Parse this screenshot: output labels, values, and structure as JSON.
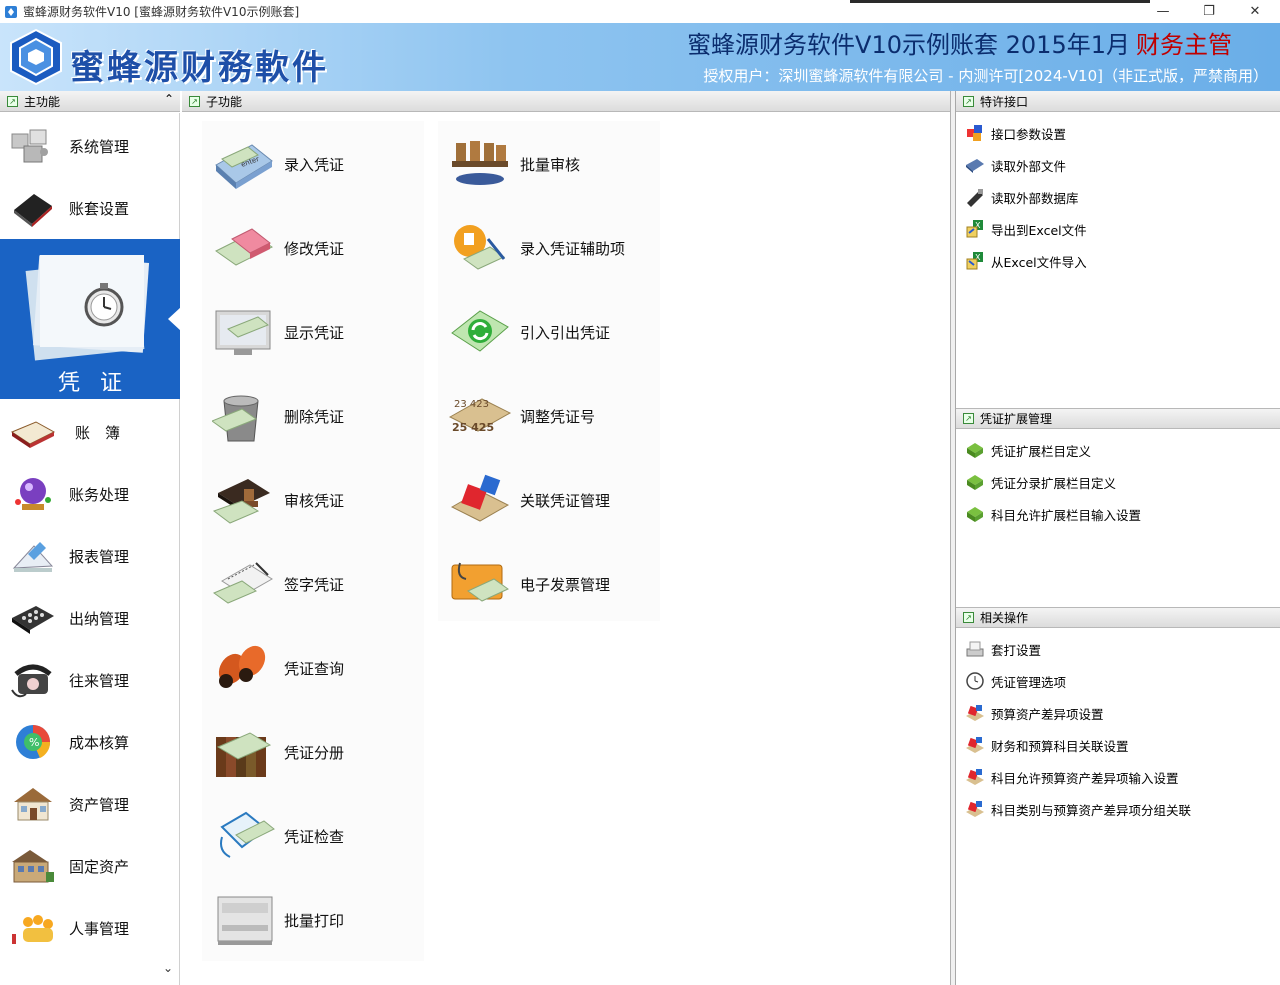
{
  "window": {
    "title": "蜜蜂源财务软件V10 [蜜蜂源财务软件V10示例账套]",
    "minimize_glyph": "—",
    "restore_glyph": "❐",
    "close_glyph": "✕"
  },
  "banner": {
    "logo_text": "蜜蜂源财務軟件",
    "account_title": "蜜蜂源财务软件V10示例账套 2015年1月",
    "role": "财务主管",
    "license": "授权用户：深圳蜜蜂源软件有限公司 - 内测许可[2024-V10]（非正式版，严禁商用）"
  },
  "left_panel": {
    "header": "主功能",
    "collapse_glyph": "⌃",
    "items_top": [
      {
        "label": "系统管理",
        "icon": "puzzle-icon"
      },
      {
        "label": "账套设置",
        "icon": "book-icon"
      }
    ],
    "selected": {
      "label": "凭证",
      "icon": "voucher-stack-icon"
    },
    "items_bottom": [
      {
        "label": "账　簿",
        "icon": "ledger-icon"
      },
      {
        "label": "账务处理",
        "icon": "crystal-ball-icon"
      },
      {
        "label": "报表管理",
        "icon": "report-icon"
      },
      {
        "label": "出纳管理",
        "icon": "cash-register-icon"
      },
      {
        "label": "往来管理",
        "icon": "phone-icon"
      },
      {
        "label": "成本核算",
        "icon": "cost-icon"
      },
      {
        "label": "资产管理",
        "icon": "house-icon"
      },
      {
        "label": "固定资产",
        "icon": "building-icon"
      },
      {
        "label": "人事管理",
        "icon": "people-icon"
      }
    ],
    "scroll_glyph": "⌄"
  },
  "middle_panel": {
    "header": "子功能",
    "col1": [
      {
        "label": "录入凭证",
        "icon": "enter-voucher-icon"
      },
      {
        "label": "修改凭证",
        "icon": "eraser-voucher-icon"
      },
      {
        "label": "显示凭证",
        "icon": "monitor-voucher-icon"
      },
      {
        "label": "删除凭证",
        "icon": "trash-voucher-icon"
      },
      {
        "label": "审核凭证",
        "icon": "stamp-voucher-icon"
      },
      {
        "label": "签字凭证",
        "icon": "sign-voucher-icon"
      },
      {
        "label": "凭证查询",
        "icon": "binoculars-icon"
      },
      {
        "label": "凭证分册",
        "icon": "books-voucher-icon"
      },
      {
        "label": "凭证检查",
        "icon": "clipboard-check-icon"
      },
      {
        "label": "批量打印",
        "icon": "printer-icon"
      }
    ],
    "col2": [
      {
        "label": "批量审核",
        "icon": "batch-stamp-icon"
      },
      {
        "label": "录入凭证辅助项",
        "icon": "assist-item-icon"
      },
      {
        "label": "引入引出凭证",
        "icon": "import-export-icon"
      },
      {
        "label": "调整凭证号",
        "icon": "renumber-icon"
      },
      {
        "label": "关联凭证管理",
        "icon": "link-puzzle-icon"
      },
      {
        "label": "电子发票管理",
        "icon": "e-invoice-icon"
      }
    ]
  },
  "right_panel": {
    "sections": [
      {
        "header": "特许接口",
        "items": [
          {
            "label": "接口参数设置",
            "icon": "puzzle-settings-icon"
          },
          {
            "label": "读取外部文件",
            "icon": "read-file-icon"
          },
          {
            "label": "读取外部数据库",
            "icon": "usb-database-icon"
          },
          {
            "label": "导出到Excel文件",
            "icon": "excel-export-icon"
          },
          {
            "label": "从Excel文件导入",
            "icon": "excel-import-icon"
          }
        ]
      },
      {
        "header": "凭证扩展管理",
        "items": [
          {
            "label": "凭证扩展栏目定义",
            "icon": "green-check-icon"
          },
          {
            "label": "凭证分录扩展栏目定义",
            "icon": "green-check-icon"
          },
          {
            "label": "科目允许扩展栏目输入设置",
            "icon": "green-check-icon"
          }
        ]
      },
      {
        "header": "相关操作",
        "items": [
          {
            "label": "套打设置",
            "icon": "print-setup-icon"
          },
          {
            "label": "凭证管理选项",
            "icon": "clock-options-icon"
          },
          {
            "label": "预算资产差异项设置",
            "icon": "red-puzzle-icon"
          },
          {
            "label": "财务和预算科目关联设置",
            "icon": "red-puzzle-icon"
          },
          {
            "label": "科目允许预算资产差异项输入设置",
            "icon": "red-puzzle-icon"
          },
          {
            "label": "科目类别与预算资产差异项分组关联",
            "icon": "red-puzzle-icon"
          }
        ]
      }
    ]
  }
}
